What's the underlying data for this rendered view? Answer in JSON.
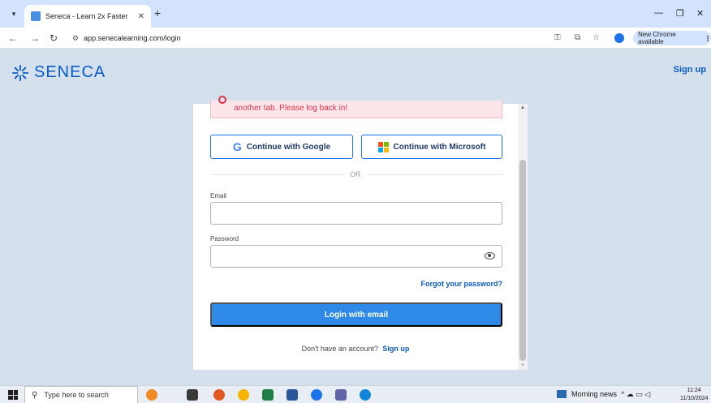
{
  "browser": {
    "tab_title": "Seneca - Learn 2x Faster",
    "new_tab_symbol": "+",
    "url": "app.senecalearning.com/login",
    "new_chrome_label": "New Chrome available",
    "minimize_symbol": "—",
    "restore_symbol": "❐",
    "close_symbol": "✕"
  },
  "header": {
    "logo_text": "SENECA",
    "signup_label": "Sign up"
  },
  "login": {
    "alert_text": "another tab. Please log back in!",
    "google_label": "Continue with Google",
    "microsoft_label": "Continue with Microsoft",
    "or_label": "OR",
    "email_label": "Email",
    "email_value": "",
    "password_label": "Password",
    "password_value": "",
    "forgot_label": "Forgot your password?",
    "login_button_label": "Login with email",
    "no_account_text": "Don't have an account?",
    "signup_link_label": "Sign up"
  },
  "taskbar": {
    "search_placeholder": "Type here to search",
    "news_label": "Morning news",
    "time": "11:24",
    "date": "11/10/2024"
  },
  "colors": {
    "brand_blue": "#0a5bc4",
    "button_blue": "#2e8ae6",
    "alert_red": "#e0314b",
    "page_bg": "#d4e0ec"
  }
}
